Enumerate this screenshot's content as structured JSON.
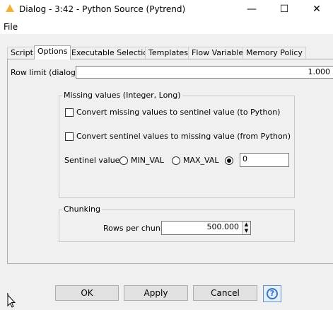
{
  "window": {
    "title": "Dialog - 3:42 - Python Source (Pytrend)",
    "minimize_glyph": "—",
    "maximize_glyph": "☐",
    "close_glyph": "✕"
  },
  "menu": {
    "file": "File"
  },
  "tabs": [
    {
      "label": "Script"
    },
    {
      "label": "Options"
    },
    {
      "label": "Executable Selection"
    },
    {
      "label": "Templates"
    },
    {
      "label": "Flow Variables"
    },
    {
      "label": "Memory Policy"
    }
  ],
  "active_tab": "Options",
  "options": {
    "row_limit_label": "Row limit (dialog)",
    "row_limit_value": "1.000",
    "missing_group_title": "Missing values (Integer, Long)",
    "convert_missing_label": "Convert missing values to sentinel value (to Python)",
    "convert_missing_checked": false,
    "convert_sentinel_label": "Convert sentinel values to missing value (from Python)",
    "convert_sentinel_checked": false,
    "sentinel_label": "Sentinel value",
    "min_val_label": "MIN_VAL",
    "max_val_label": "MAX_VAL",
    "sentinel_custom_value": "0",
    "sentinel_selected": "custom",
    "chunking_title": "Chunking",
    "rows_per_chunk_label": "Rows per chunk",
    "rows_per_chunk_value": "500.000"
  },
  "buttons": {
    "ok": "OK",
    "apply": "Apply",
    "cancel": "Cancel",
    "help": "?"
  },
  "colors": {
    "logo": "#f2b233",
    "help_accent": "#2f78d0"
  }
}
